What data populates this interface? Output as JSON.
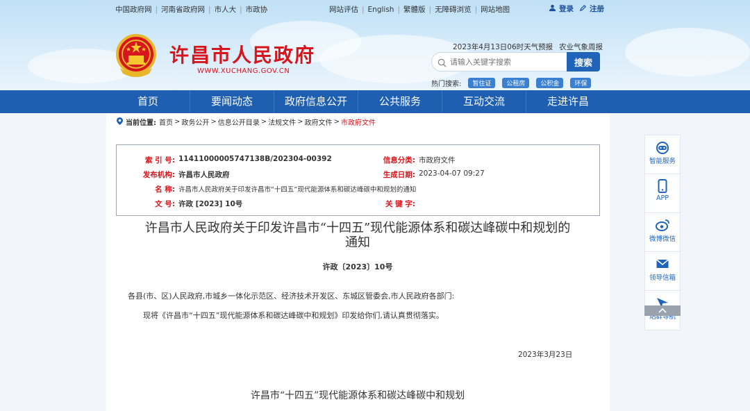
{
  "topbar": {
    "left_links": [
      "中国政府网",
      "河南省政府网",
      "市人大",
      "市政协"
    ],
    "center_links": [
      "网站评估",
      "English",
      "繁體版",
      "无障碍浏览",
      "网站地图"
    ],
    "login": "登录",
    "register": "注册"
  },
  "header": {
    "site_name": "许昌市人民政府",
    "site_url": "WWW.XUCHANG.GOV.CN",
    "weather": "2023年4月13日06时天气预报",
    "agri_weather": "农业气象周报",
    "search_placeholder": "请输入关键字搜索",
    "search_button": "搜索",
    "hot_label": "热门搜索:",
    "hot_tags": [
      "暂住证",
      "公租房",
      "公积金",
      "环保"
    ],
    "brand_color": "#d7151d",
    "nav_color": "#1e5fb2"
  },
  "nav": [
    "首页",
    "要闻动态",
    "政府信息公开",
    "公共服务",
    "互动交流",
    "走进许昌"
  ],
  "breadcrumb": {
    "label": "当前位置:",
    "items": [
      "首页",
      "政务公开",
      "信息公开目录",
      "法规文件",
      "政府文件"
    ],
    "current": "市政府文件",
    "separator": ">"
  },
  "meta": {
    "index_label": "索 引 号:",
    "index_value": "11411000005747138B/202304-00392",
    "category_label": "信息分类:",
    "category_value": "市政府文件",
    "org_label": "发布机构:",
    "org_value": "许昌市人民政府",
    "date_label": "生成日期:",
    "date_value": "2023-04-07 09:27",
    "name_label": "名 称:",
    "name_value": "许昌市人民政府关于印发许昌市“十四五”现代能源体系和碳达峰碳中和规划的通知",
    "docno_label": "文 号:",
    "docno_value": "许政 [2023] 10号",
    "keyword_label": "关 键 字:",
    "keyword_value": ""
  },
  "document": {
    "title_line1": "许昌市人民政府关于印发许昌市“十四五”现代能源体系和碳达峰碳中和规划的",
    "title_line2": "通知",
    "doc_no": "许政〔2023〕10号",
    "addressee": "各县(市、区)人民政府,市城乡一体化示范区、经济技术开发区、东城区管委会,市人民政府各部门:",
    "body": "现将《许昌市“十四五”现代能源体系和碳达峰碳中和规划》印发给你们,请认真贯彻落实。",
    "date": "2023年3月23日",
    "plan_title": "许昌市“十四五”现代能源体系和碳达峰碳中和规划"
  },
  "sidebar": [
    {
      "icon": "robot-icon",
      "label": "智能服务"
    },
    {
      "icon": "phone-icon",
      "label": "APP"
    },
    {
      "icon": "weibo-icon",
      "label": "微博微信"
    },
    {
      "icon": "mail-icon",
      "label": "领导信箱"
    },
    {
      "icon": "send-icon",
      "label": "站群导航"
    }
  ]
}
